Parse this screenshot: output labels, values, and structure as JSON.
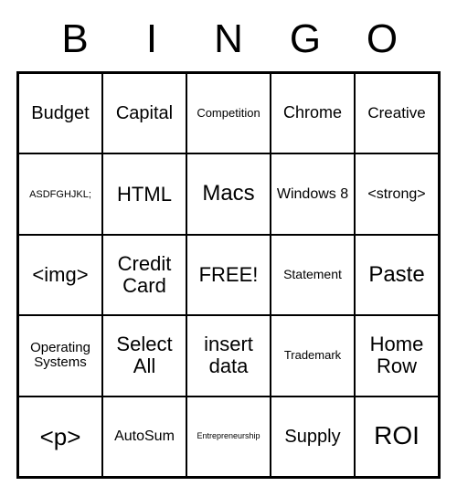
{
  "header": {
    "letters": [
      "B",
      "I",
      "N",
      "G",
      "O"
    ]
  },
  "grid": {
    "rows": [
      [
        {
          "text": "Budget",
          "size": "20px"
        },
        {
          "text": "Capital",
          "size": "20px"
        },
        {
          "text": "Competition",
          "size": "13px"
        },
        {
          "text": "Chrome",
          "size": "18px"
        },
        {
          "text": "Creative",
          "size": "17px"
        }
      ],
      [
        {
          "text": "ASDFGHJKL;",
          "size": "11px"
        },
        {
          "text": "HTML",
          "size": "22px"
        },
        {
          "text": "Macs",
          "size": "24px"
        },
        {
          "text": "Windows 8",
          "size": "16px"
        },
        {
          "text": "<strong>",
          "size": "16px"
        }
      ],
      [
        {
          "text": "<img>",
          "size": "22px"
        },
        {
          "text": "Credit Card",
          "size": "22px"
        },
        {
          "text": "FREE!",
          "size": "22px"
        },
        {
          "text": "Statement",
          "size": "14px"
        },
        {
          "text": "Paste",
          "size": "24px"
        }
      ],
      [
        {
          "text": "Operating Systems",
          "size": "15px"
        },
        {
          "text": "Select All",
          "size": "22px"
        },
        {
          "text": "insert data",
          "size": "22px"
        },
        {
          "text": "Trademark",
          "size": "13px"
        },
        {
          "text": "Home Row",
          "size": "22px"
        }
      ],
      [
        {
          "text": "<p>",
          "size": "26px"
        },
        {
          "text": "AutoSum",
          "size": "16px"
        },
        {
          "text": "Entrepreneurship",
          "size": "9px"
        },
        {
          "text": "Supply",
          "size": "20px"
        },
        {
          "text": "ROI",
          "size": "28px"
        }
      ]
    ]
  }
}
